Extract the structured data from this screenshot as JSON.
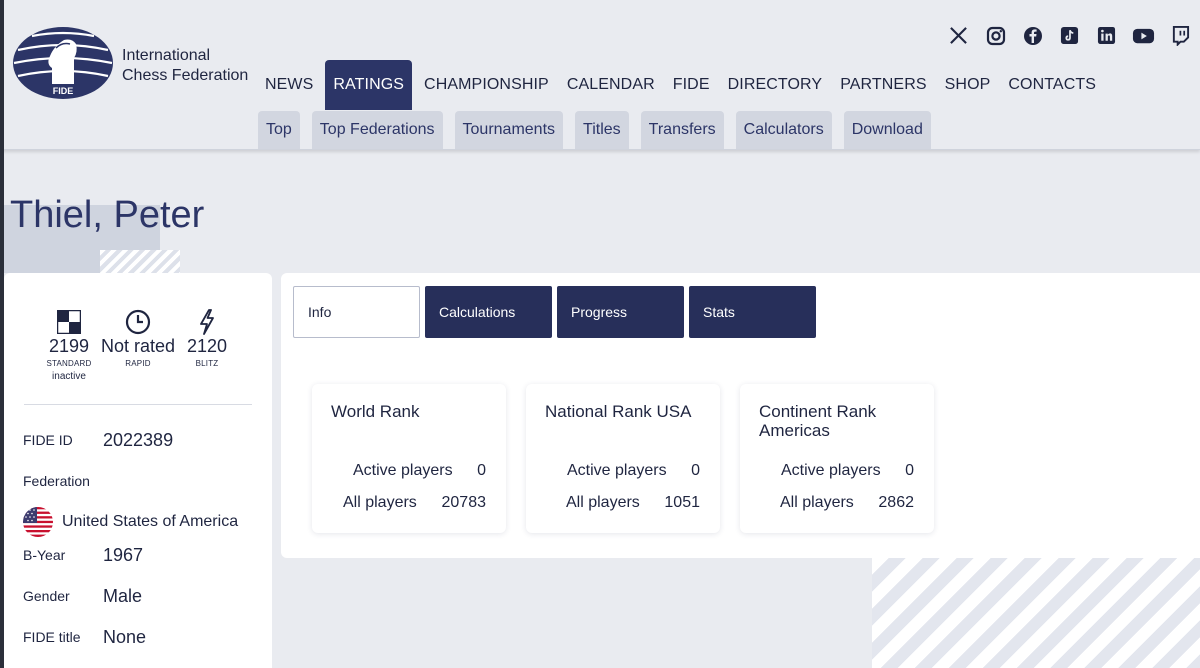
{
  "org": {
    "line1": "International",
    "line2": "Chess Federation",
    "logo_text": "FIDE"
  },
  "social_icons": [
    "x-icon",
    "instagram-icon",
    "facebook-icon",
    "tiktok-icon",
    "linkedin-icon",
    "youtube-icon",
    "twitch-icon"
  ],
  "nav": {
    "items": [
      "NEWS",
      "RATINGS",
      "CHAMPIONSHIP",
      "CALENDAR",
      "FIDE",
      "DIRECTORY",
      "PARTNERS",
      "SHOP",
      "CONTACTS"
    ],
    "active": "RATINGS"
  },
  "subnav": [
    "Top",
    "Top Federations",
    "Tournaments",
    "Titles",
    "Transfers",
    "Calculators",
    "Download"
  ],
  "player": {
    "name": "Thiel, Peter",
    "ratings": {
      "standard": {
        "value": "2199",
        "label": "STANDARD",
        "note": "inactive"
      },
      "rapid": {
        "value": "Not rated",
        "label": "RAPID"
      },
      "blitz": {
        "value": "2120",
        "label": "BLITZ"
      }
    },
    "fide_id_label": "FIDE ID",
    "fide_id": "2022389",
    "federation_label": "Federation",
    "federation": "United States of America",
    "byear_label": "B-Year",
    "byear": "1967",
    "gender_label": "Gender",
    "gender": "Male",
    "title_label": "FIDE title",
    "title": "None"
  },
  "tabs": [
    "Info",
    "Calculations",
    "Progress",
    "Stats"
  ],
  "active_tab": "Info",
  "ranks": [
    {
      "title": "World Rank",
      "active_label": "Active players",
      "active": "0",
      "all_label": "All players",
      "all": "20783"
    },
    {
      "title": "National Rank USA",
      "active_label": "Active players",
      "active": "0",
      "all_label": "All players",
      "all": "1051"
    },
    {
      "title": "Continent Rank Americas",
      "active_label": "Active players",
      "active": "0",
      "all_label": "All players",
      "all": "2862"
    }
  ],
  "colors": {
    "brand_navy": "#2c3567",
    "tab_dark": "#272f5a",
    "page_bg": "#e9ebf0"
  }
}
